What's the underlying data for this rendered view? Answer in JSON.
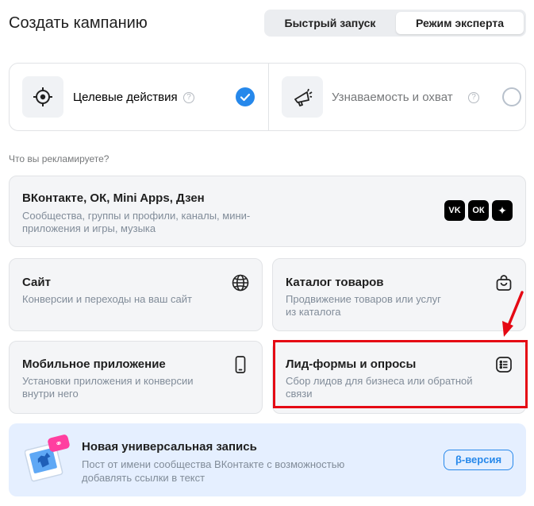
{
  "header": {
    "title": "Создать кампанию",
    "tabs": [
      {
        "label": "Быстрый запуск",
        "active": false
      },
      {
        "label": "Режим эксперта",
        "active": true
      }
    ]
  },
  "goals": [
    {
      "label": "Целевые действия",
      "icon": "target-icon",
      "help": "?",
      "selected": true
    },
    {
      "label": "Узнаваемость и охват",
      "icon": "megaphone-icon",
      "help": "?",
      "selected": false
    }
  ],
  "section_label": "Что вы рекламируете?",
  "cards": {
    "vk": {
      "title": "ВКонтакте, ОК, Mini Apps, Дзен",
      "desc_line1": "Сообщества, группы и профили, каналы, мини-",
      "desc_line2": "приложения и игры, музыка",
      "icons": [
        "vk-icon",
        "ok-icon",
        "dzen-icon"
      ],
      "icon_labels": [
        "VK",
        "ОК",
        "✦"
      ]
    },
    "site": {
      "title": "Сайт",
      "desc_line1": "Конверсии и переходы на ваш сайт",
      "desc_line2": "",
      "icon": "globe-icon"
    },
    "catalog": {
      "title": "Каталог товаров",
      "desc_line1": "Продвижение товаров или услуг",
      "desc_line2": "из каталога",
      "icon": "shopping-bag-icon"
    },
    "mobile": {
      "title": "Мобильное приложение",
      "desc_line1": "Установки приложения и конверсии",
      "desc_line2": "внутри него",
      "icon": "smartphone-icon"
    },
    "leadforms": {
      "title": "Лид-формы и опросы",
      "desc_line1": "Сбор лидов для бизнеса или обратной",
      "desc_line2": "связи",
      "icon": "list-icon",
      "highlighted": true
    }
  },
  "promo": {
    "title": "Новая универсальная запись",
    "desc_line1": "Пост от имени сообщества ВКонтакте с возможностью",
    "desc_line2": "добавлять ссылки в текст",
    "button": "β-версия",
    "icon": "post-illustration-icon"
  },
  "colors": {
    "accent": "#2688eb",
    "highlight": "#e50914",
    "card_bg": "#f4f5f7",
    "promo_bg": "#e5efff"
  }
}
